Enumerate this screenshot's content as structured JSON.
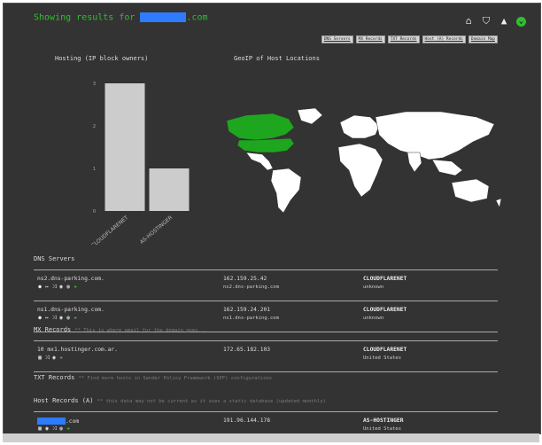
{
  "header": {
    "title_prefix": "Showing results for",
    "title_suffix": ".com",
    "icons": [
      "home-icon",
      "shield-icon",
      "graduation-cap-icon",
      "chevron-circle-icon"
    ]
  },
  "tabs": [
    "DNS Servers",
    "MX Records",
    "TXT Records",
    "Host (A) Records",
    "Domain Map"
  ],
  "hosting": {
    "title": "Hosting (IP block owners)"
  },
  "geoip": {
    "title": "GeoIP of Host Locations",
    "highlighted": [
      "Canada",
      "United States"
    ],
    "land_color": "#ffffff",
    "highlight_color": "#1ea61e"
  },
  "chart_data": {
    "type": "bar",
    "categories": [
      "CLOUDFLARENET",
      "AS-HOSTINGER"
    ],
    "values": [
      3,
      1
    ],
    "ylim": [
      0,
      3
    ],
    "yticks": [
      "0",
      "1",
      "2",
      "3"
    ],
    "bar_color": "#cccccc"
  },
  "dns": {
    "title": "DNS Servers",
    "rows": [
      {
        "host": "ns2.dns-parking.com.",
        "ip": "162.159.25.42",
        "ptr": "ns2.dns-parking.com",
        "asn": "CLOUDFLARENET",
        "country": "unknown"
      },
      {
        "host": "ns1.dns-parking.com.",
        "ip": "162.159.24.201",
        "ptr": "ns1.dns-parking.com",
        "asn": "CLOUDFLARENET",
        "country": "unknown"
      }
    ]
  },
  "mx": {
    "title": "MX Records",
    "note": "** This is where email for the domain goes...",
    "rows": [
      {
        "host": "10 mx1.hostinger.com.ar.",
        "ip": "172.65.182.103",
        "asn": "CLOUDFLARENET",
        "country": "United States"
      }
    ]
  },
  "txt": {
    "title": "TXT Records",
    "note": "** Find more hosts in Sender Policy Framework (SPF) configurations"
  },
  "hostA": {
    "title": "Host Records (A)",
    "note": "** this data may not be current as it uses a static database (updated monthly)",
    "rows": [
      {
        "host_suffix": ".com",
        "ip": "191.96.144.178",
        "asn": "AS-HOSTINGER",
        "country": "United States"
      }
    ]
  }
}
